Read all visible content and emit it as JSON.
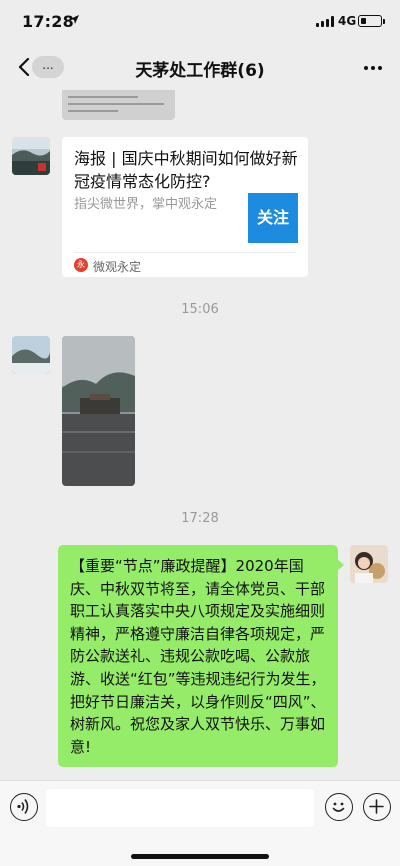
{
  "status_bar": {
    "time": "17:28",
    "network": "4G"
  },
  "nav": {
    "back_pill": "...",
    "title": "天茅处工作群(6)"
  },
  "messages": {
    "article_card": {
      "title": "海报 | 国庆中秋期间如何做好新冠疫情常态化防控?",
      "description": "指尖微世界，掌中观永定",
      "thumb_label": "关注",
      "source_icon": "永",
      "source_name": "微观永定"
    },
    "timestamp_1": "15:06",
    "timestamp_2": "17:28",
    "text_message": "【重要“节点”廉政提醒】2020年国庆、中秋双节将至，请全体党员、干部职工认真落实中央八项规定及实施细则精神，严格遵守廉洁自律各项规定，严防公款送礼、违规公款吃喝、公款旅游、收送“红包”等违规违纪行为发生，把好节日廉洁关，以身作则反“四风”、树新风。祝您及家人双节快乐、万事如意!"
  },
  "input_bar": {
    "value": ""
  },
  "colors": {
    "bubble_green": "#95ec69",
    "follow_blue": "#1d8be0",
    "background": "#ededed"
  }
}
